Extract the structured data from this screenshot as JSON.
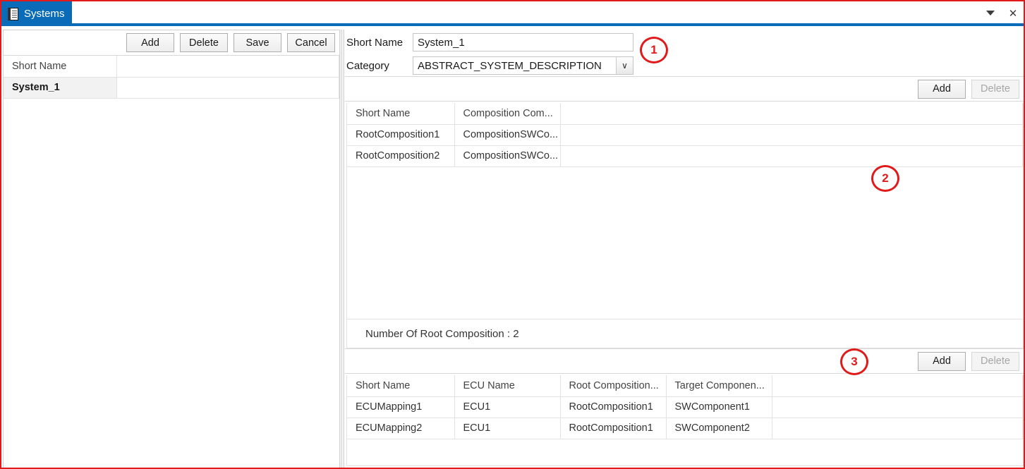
{
  "window": {
    "tab_label": "Systems",
    "tab_icon": "document-list-icon",
    "minimize_icon": "chevron-down-icon",
    "close_icon": "close-icon",
    "close_glyph": "✕",
    "border_color": "#e01a1a",
    "accent_color": "#0a6cb8"
  },
  "left_panel": {
    "toolbar": {
      "add_label": "Add",
      "delete_label": "Delete",
      "save_label": "Save",
      "cancel_label": "Cancel"
    },
    "grid": {
      "headers": [
        "Short Name",
        ""
      ],
      "rows": [
        {
          "cells": [
            "System_1",
            ""
          ],
          "selected": true
        }
      ]
    }
  },
  "details": {
    "form": {
      "short_name_label": "Short Name",
      "short_name_value": "System_1",
      "category_label": "Category",
      "category_value": "ABSTRACT_SYSTEM_DESCRIPTION",
      "dropdown_icon": "chevron-down-icon",
      "dropdown_glyph": "∨"
    },
    "compositions": {
      "toolbar": {
        "add_label": "Add",
        "delete_label": "Delete",
        "delete_disabled": true
      },
      "headers": [
        "Short Name",
        "Composition Com...",
        ""
      ],
      "rows": [
        {
          "cells": [
            "RootComposition1",
            "CompositionSWCo...",
            ""
          ]
        },
        {
          "cells": [
            "RootComposition2",
            "CompositionSWCo...",
            ""
          ]
        }
      ],
      "count_text": "Number Of Root Composition : 2"
    },
    "mappings": {
      "toolbar": {
        "add_label": "Add",
        "delete_label": "Delete",
        "delete_disabled": true
      },
      "headers": [
        "Short Name",
        "ECU Name",
        "Root Composition...",
        "Target Componen...",
        ""
      ],
      "rows": [
        {
          "cells": [
            "ECUMapping1",
            "ECU1",
            "RootComposition1",
            "SWComponent1",
            ""
          ]
        },
        {
          "cells": [
            "ECUMapping2",
            "ECU1",
            "RootComposition1",
            "SWComponent2",
            ""
          ]
        }
      ]
    }
  },
  "annotations": [
    {
      "label": "1"
    },
    {
      "label": "2"
    },
    {
      "label": "3"
    }
  ]
}
